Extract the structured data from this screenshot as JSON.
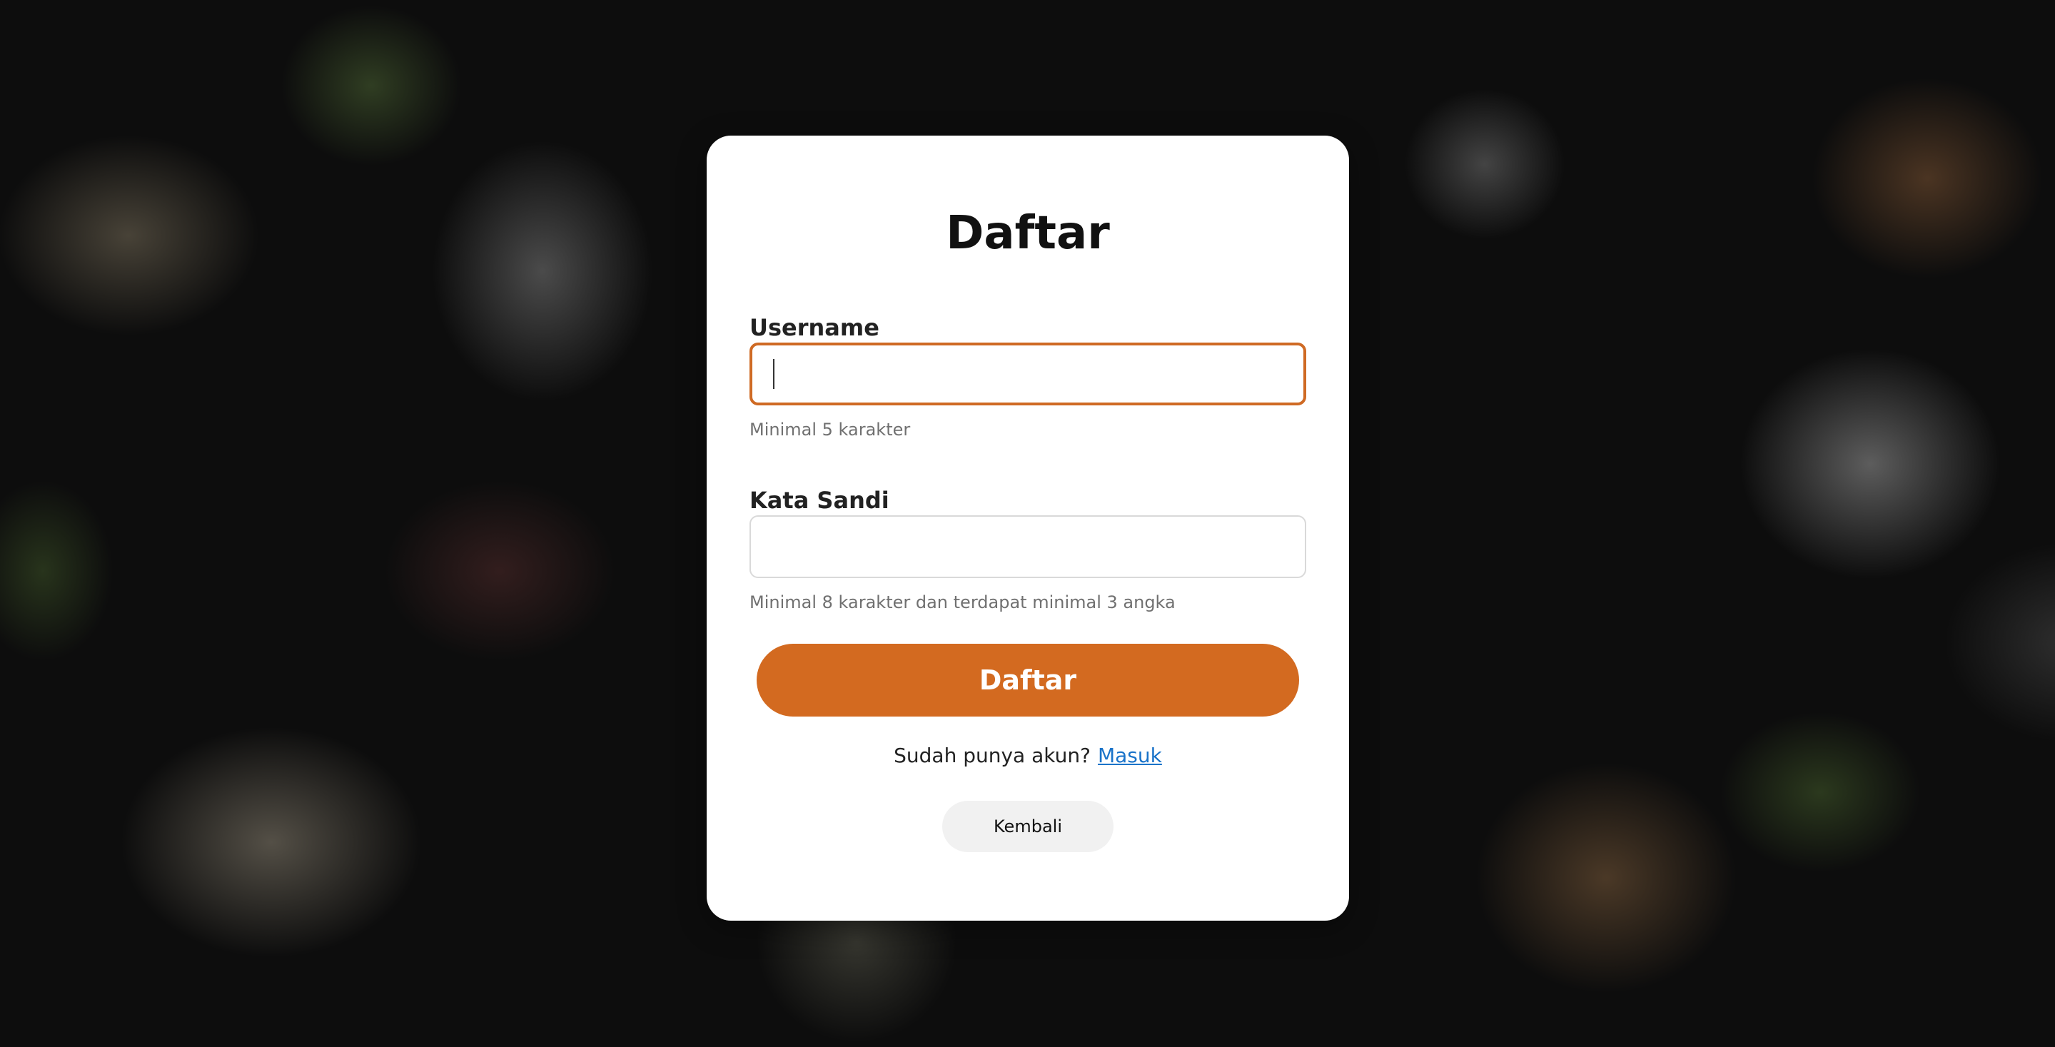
{
  "form": {
    "title": "Daftar",
    "username": {
      "label": "Username",
      "value": "",
      "placeholder": "",
      "hint": "Minimal 5 karakter"
    },
    "password": {
      "label": "Kata Sandi",
      "value": "",
      "placeholder": "",
      "hint": "Minimal 8 karakter dan terdapat minimal 3 angka"
    },
    "submit_label": "Daftar",
    "login_prompt": "Sudah punya akun?",
    "login_link": "Masuk",
    "back_label": "Kembali"
  },
  "colors": {
    "accent": "#d36a20",
    "focus_border": "#cf6a24",
    "link": "#1a73c9",
    "hint_text": "#707070",
    "card_bg": "#ffffff"
  }
}
